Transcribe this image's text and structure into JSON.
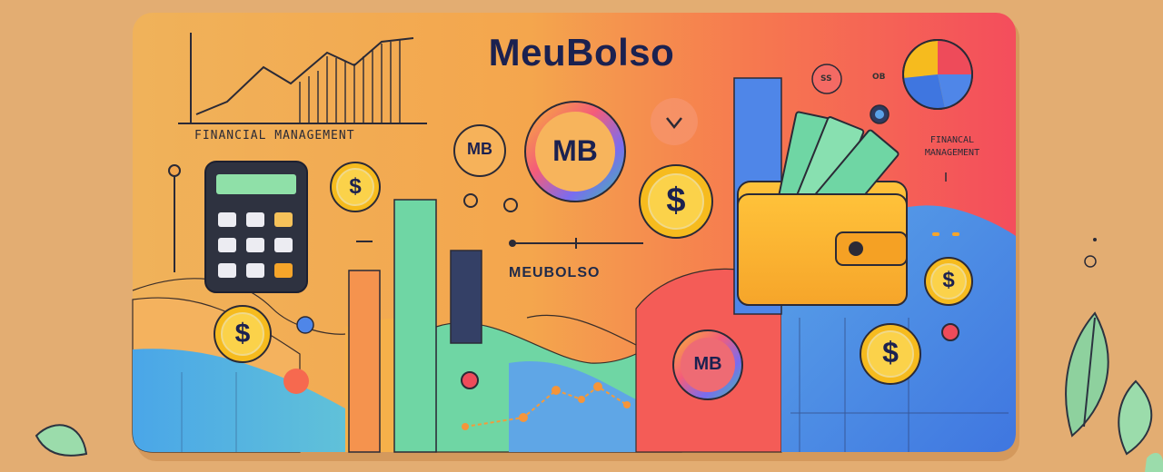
{
  "brand": {
    "title": "MeuBolso",
    "subtitle": "MEUBOLSO",
    "tagline_left": "FINANCIAL MANAGEMENT",
    "tagline_right_line1": "FINANCAL",
    "tagline_right_line2": "MANAGEMENT"
  },
  "logo_marks": {
    "small": "MB",
    "large": "MB",
    "bottom": "MB"
  },
  "coins": {
    "symbol": "$"
  },
  "tiny_labels": {
    "label_a": "SS",
    "label_b": "OB"
  },
  "colors": {
    "background": "#e3ad72",
    "card_orange": "#f2a84e",
    "card_red": "#f25a5a",
    "accent_blue": "#4f86e8",
    "accent_green": "#6fd6a4",
    "coin_gold": "#f6bb1e",
    "navy": "#1b2150"
  },
  "icons": [
    "line-chart-icon",
    "calculator-icon",
    "wallet-icon",
    "banknote-icon",
    "pie-chart-icon",
    "coin-icon",
    "leaf-icon",
    "heart-icon"
  ]
}
